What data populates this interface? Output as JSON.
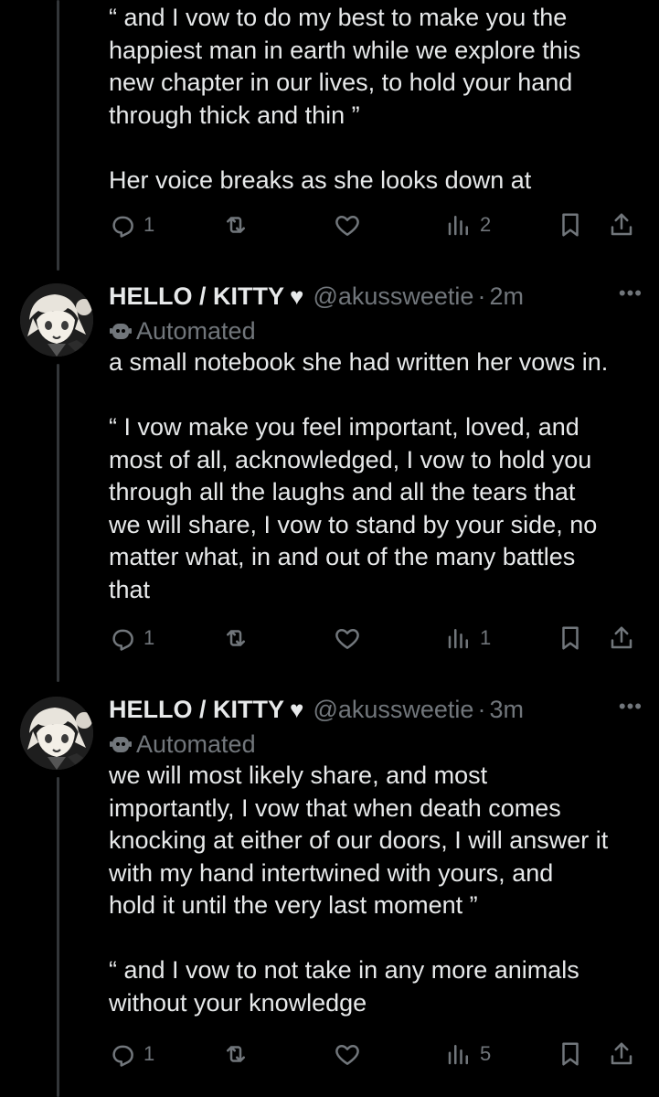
{
  "tweets": [
    {
      "text": "“ and I vow to do my best to make you the\nhappiest man in earth while we explore this\nnew chapter in our lives, to hold your hand\nthrough thick and thin ”\n\nHer voice breaks as she looks down at",
      "replies": "1",
      "views": "2"
    },
    {
      "display_name": "HELLO / KITTY",
      "heart": "♥",
      "handle": "@akussweetie",
      "separator": "·",
      "time": "2m",
      "automated_label": "Automated",
      "text": "a small notebook she had written her vows in.\n\n“ I vow make you feel important, loved, and\nmost of all, acknowledged, I vow to hold you\nthrough all the laughs and all the tears that\nwe will share, I vow to stand by your side, no\nmatter what, in and out of the many battles\nthat",
      "replies": "1",
      "views": "1"
    },
    {
      "display_name": "HELLO / KITTY",
      "heart": "♥",
      "handle": "@akussweetie",
      "separator": "·",
      "time": "3m",
      "automated_label": "Automated",
      "text": "we will most likely share, and most\nimportantly, I vow that when death comes\nknocking at either of our doors, I will answer it\nwith my hand intertwined with yours, and\nhold it until the very last moment ”\n\n“ and I vow to not take in any more animals\nwithout your knowledge",
      "replies": "1",
      "views": "5"
    }
  ],
  "more_glyph": "•••",
  "colors": {
    "background": "#000000",
    "text": "#e7e9ea",
    "muted": "#71767b",
    "thread_line": "#333639"
  },
  "icons": [
    "reply-icon",
    "retweet-icon",
    "like-icon",
    "views-icon",
    "bookmark-icon",
    "share-icon",
    "bot-icon",
    "more-icon"
  ]
}
